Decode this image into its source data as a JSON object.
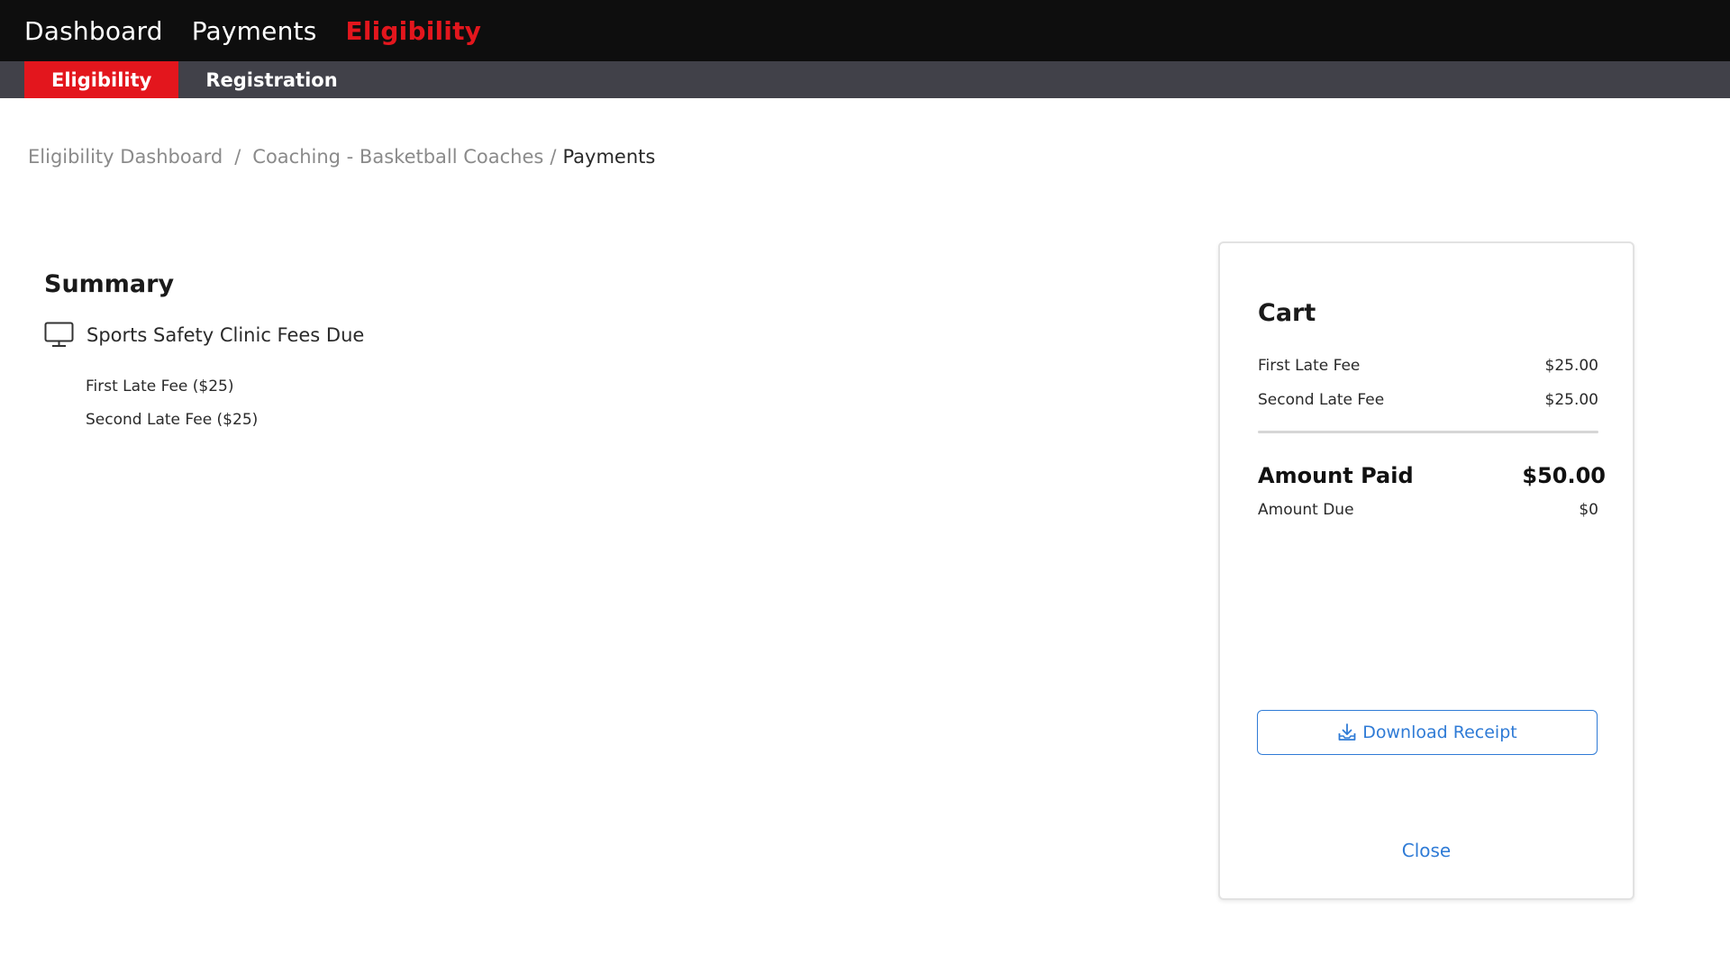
{
  "topnav": {
    "items": [
      {
        "label": "Dashboard"
      },
      {
        "label": "Payments"
      },
      {
        "label": "Eligibility"
      }
    ]
  },
  "subnav": {
    "items": [
      {
        "label": "Eligibility"
      },
      {
        "label": "Registration"
      }
    ]
  },
  "breadcrumb": {
    "items": [
      {
        "label": "Eligibility Dashboard"
      },
      {
        "label": "Coaching - Basketball Coaches"
      },
      {
        "label": "Payments"
      }
    ],
    "separator": "/"
  },
  "summary": {
    "title": "Summary",
    "group_label": "Sports Safety Clinic Fees Due",
    "group_icon": "monitor-icon",
    "items": [
      {
        "label": "First Late Fee ($25)"
      },
      {
        "label": "Second Late Fee ($25)"
      }
    ]
  },
  "cart": {
    "title": "Cart",
    "fees": [
      {
        "label": "First Late Fee",
        "amount": "$25.00"
      },
      {
        "label": "Second Late Fee",
        "amount": "$25.00"
      }
    ],
    "amount_paid_label": "Amount Paid",
    "amount_paid_value": "$50.00",
    "amount_due_label": "Amount Due",
    "amount_due_value": "$0",
    "download_label": "Download Receipt",
    "download_icon": "download-icon",
    "close_label": "Close"
  },
  "colors": {
    "accent": "#e3161d",
    "link": "#2f7bd6",
    "topbar": "#0e0e0e",
    "subbar": "#414149"
  }
}
